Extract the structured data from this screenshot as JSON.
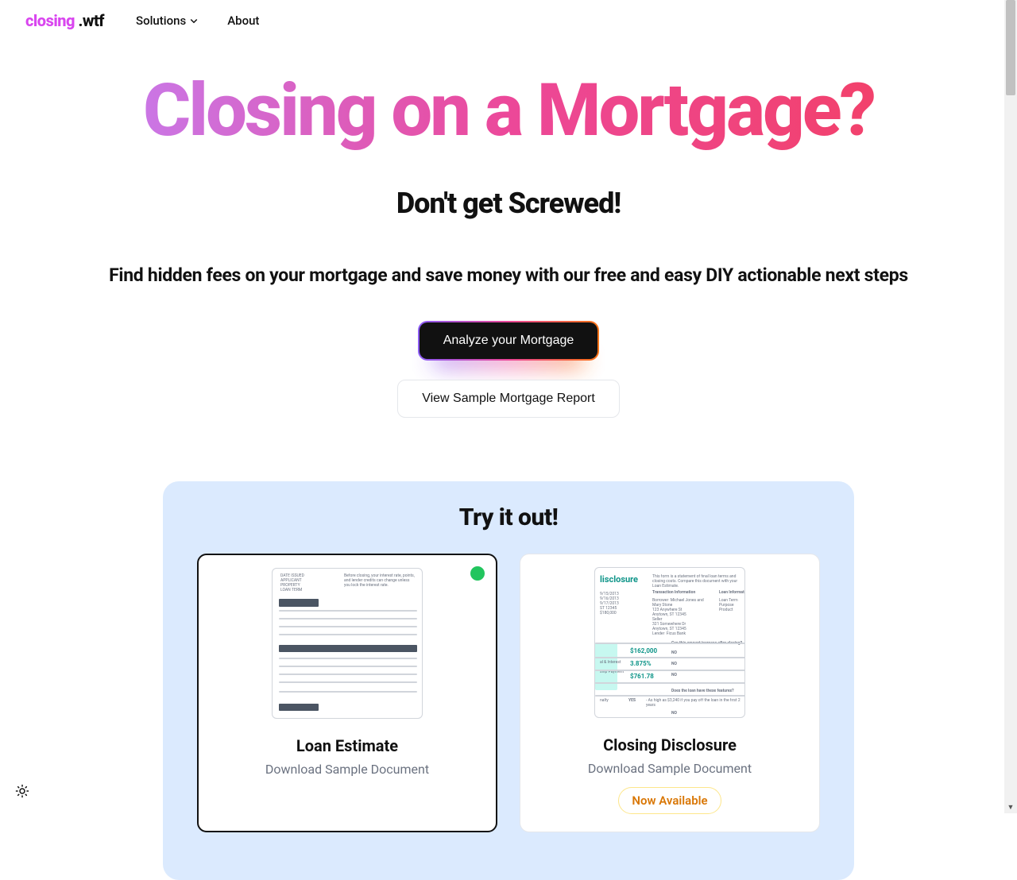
{
  "nav": {
    "logo_pink": "closing",
    "logo_wtf": " .wtf",
    "solutions": "Solutions",
    "about": "About"
  },
  "hero": {
    "title": "Closing on a Mortgage?",
    "sub1": "Don't get Screwed!",
    "sub2": "Find hidden fees on your mortgage and save money with our free and easy DIY actionable next steps",
    "cta_primary": "Analyze your Mortgage",
    "cta_secondary": "View Sample Mortgage Report"
  },
  "try": {
    "title": "Try it out!",
    "cards": [
      {
        "title": "Loan Estimate",
        "sub": "Download Sample Document"
      },
      {
        "title": "Closing Disclosure",
        "sub": "Download Sample Document",
        "badge": "Now Available"
      }
    ]
  }
}
